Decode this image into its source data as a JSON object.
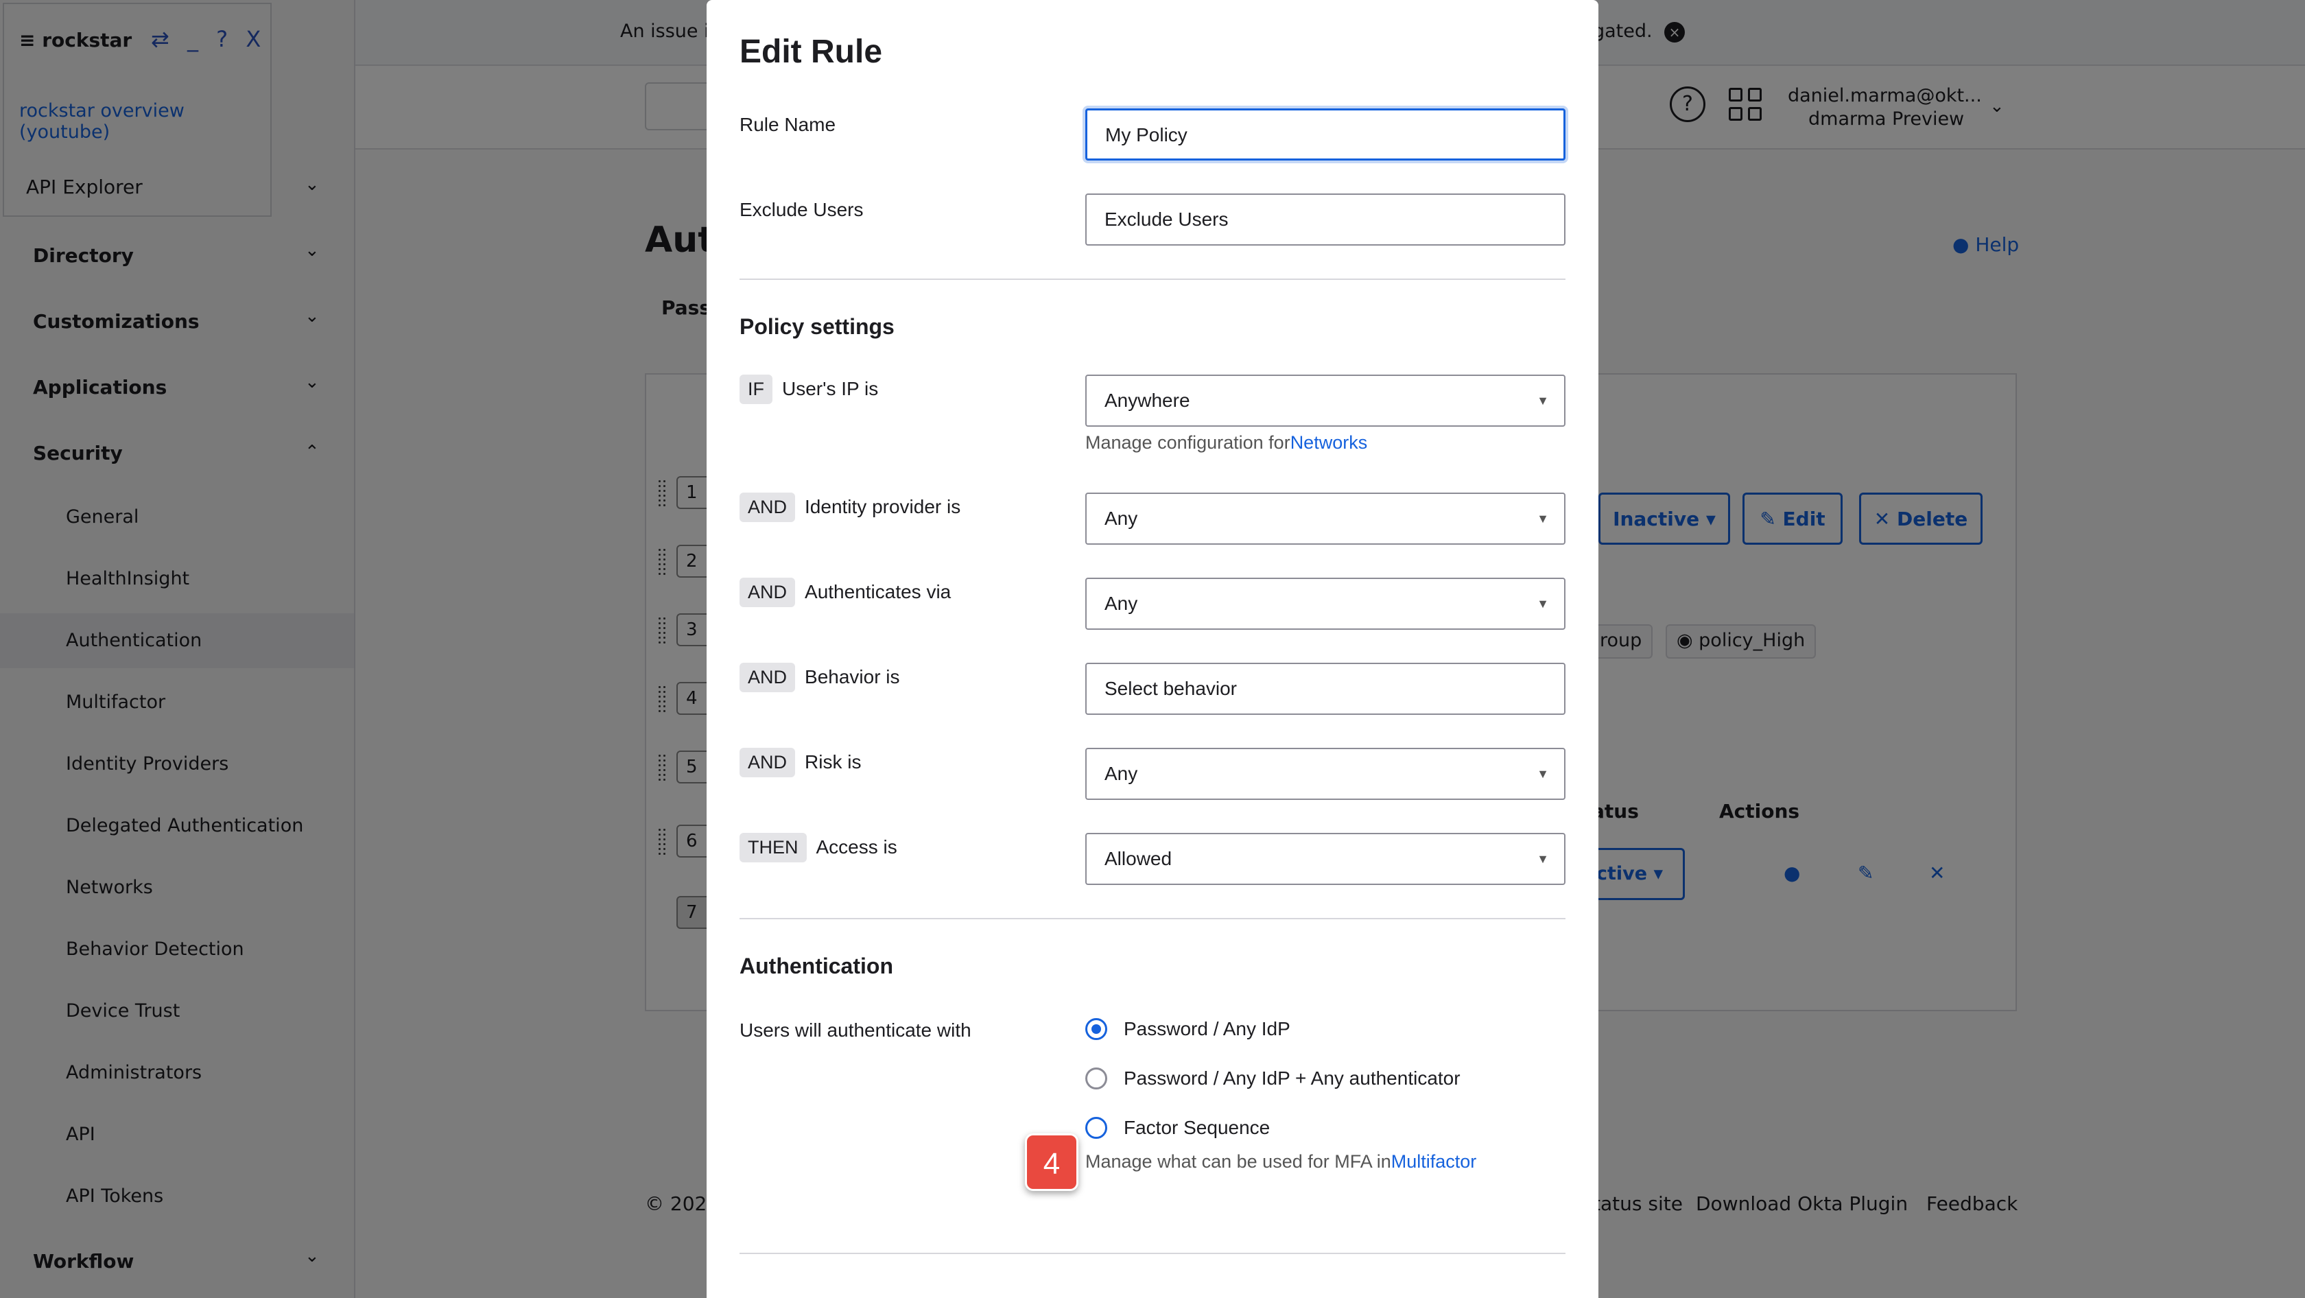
{
  "rockstar": {
    "title": "≡ rockstar",
    "controls": "⇄ _ ? X",
    "overview_link": "rockstar overview (youtube)",
    "api_explorer": "API Explorer"
  },
  "banner": {
    "text_left": "An issue i",
    "text_right": "gated."
  },
  "user": {
    "name": "daniel.marma@okt...",
    "org": "dmarma Preview"
  },
  "sidebar": {
    "groups": [
      {
        "label": "Directory"
      },
      {
        "label": "Customizations"
      },
      {
        "label": "Applications"
      },
      {
        "label": "Security"
      },
      {
        "label": "Workflow"
      }
    ],
    "security_items": [
      {
        "label": "General"
      },
      {
        "label": "HealthInsight"
      },
      {
        "label": "Authentication"
      },
      {
        "label": "Multifactor"
      },
      {
        "label": "Identity Providers"
      },
      {
        "label": "Delegated Authentication"
      },
      {
        "label": "Networks"
      },
      {
        "label": "Behavior Detection"
      },
      {
        "label": "Device Trust"
      },
      {
        "label": "Administrators"
      },
      {
        "label": "API"
      },
      {
        "label": "API Tokens"
      }
    ]
  },
  "background": {
    "page_title": "Aut",
    "help": "Help",
    "tab": "Pass",
    "inactive_button": "Inactive ▾",
    "edit_button": "✎ Edit",
    "delete_button": "✕ Delete",
    "chip_group": "roup",
    "chip_policy": "policy_High",
    "col_status": "atus",
    "col_actions": "Actions",
    "active_button": "ctive ▾",
    "row_numbers": [
      "1",
      "2",
      "3",
      "4",
      "5",
      "6",
      "7"
    ],
    "footer_copyright": "© 202",
    "footer_status": "tatus site",
    "footer_plugin": "Download Okta Plugin",
    "footer_feedback": "Feedback"
  },
  "modal": {
    "title": "Edit Rule",
    "rule_name_label": "Rule Name",
    "rule_name_value": "My Policy",
    "exclude_label": "Exclude Users",
    "exclude_value": "Exclude Users",
    "policy_settings_title": "Policy settings",
    "conditions": [
      {
        "tag": "IF",
        "label": "User's IP is",
        "value": "Anywhere"
      },
      {
        "tag": "AND",
        "label": "Identity provider is",
        "value": "Any"
      },
      {
        "tag": "AND",
        "label": "Authenticates via",
        "value": "Any"
      },
      {
        "tag": "AND",
        "label": "Behavior is",
        "value": "Select behavior"
      },
      {
        "tag": "AND",
        "label": "Risk is",
        "value": "Any"
      },
      {
        "tag": "THEN",
        "label": "Access is",
        "value": "Allowed"
      }
    ],
    "networks_help_prefix": "Manage configuration for",
    "networks_link": "Networks",
    "authentication_title": "Authentication",
    "auth_label": "Users will authenticate with",
    "auth_options": [
      {
        "label": "Password / Any IdP",
        "checked": true
      },
      {
        "label": "Password / Any IdP + Any authenticator",
        "checked": false
      },
      {
        "label": "Factor Sequence",
        "checked": false
      }
    ],
    "mfa_help_prefix": "Manage what can be used for MFA in",
    "mfa_link": "Multifactor"
  },
  "step_badge": "4",
  "colors": {
    "accent": "#1662dd",
    "badge": "#e9493f"
  }
}
